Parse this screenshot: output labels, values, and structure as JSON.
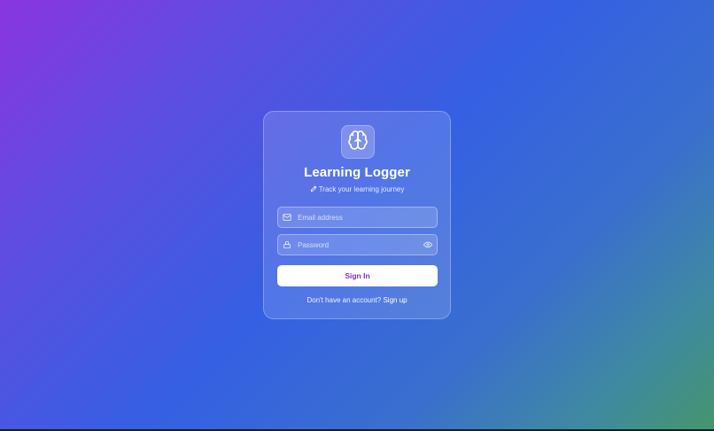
{
  "app": {
    "title": "Learning Logger",
    "subtitle_icon": "pencil-icon",
    "subtitle": "Track your learning journey",
    "logo_icon": "brain-icon"
  },
  "form": {
    "email": {
      "icon": "mail-icon",
      "placeholder": "Email address",
      "value": ""
    },
    "password": {
      "icon": "lock-icon",
      "placeholder": "Password",
      "value": "",
      "toggle_icon": "eye-icon"
    },
    "submit_label": "Sign In"
  },
  "footer": {
    "prompt": "Don't have an account?",
    "link_label": "Sign up"
  },
  "colors": {
    "gradient_start": "#8a36e0",
    "gradient_mid": "#3560e3",
    "gradient_end": "#46956c",
    "button_text": "#7b2fd4"
  }
}
